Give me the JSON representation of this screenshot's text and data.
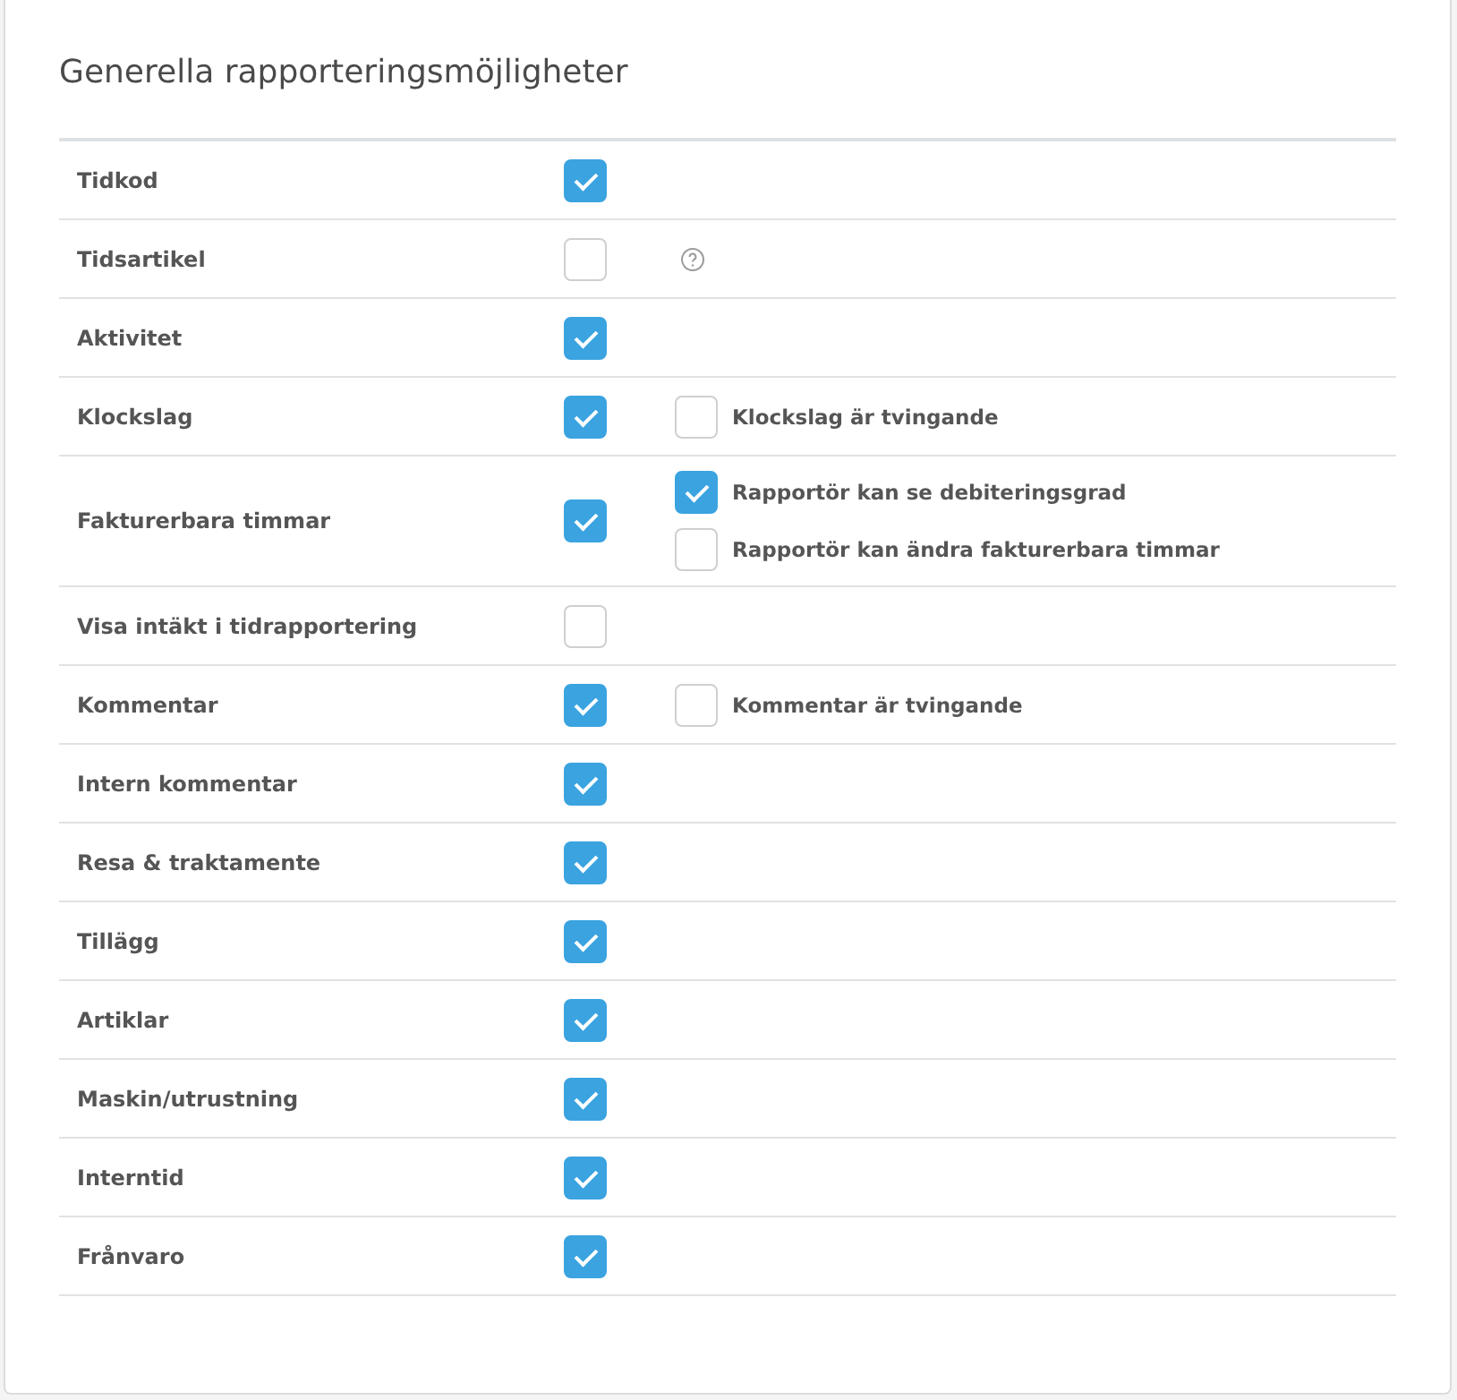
{
  "title": "Generella rapporteringsmöjligheter",
  "rows": [
    {
      "label": "Tidkod",
      "checked": true,
      "help": false,
      "options": []
    },
    {
      "label": "Tidsartikel",
      "checked": false,
      "help": true,
      "options": []
    },
    {
      "label": "Aktivitet",
      "checked": true,
      "help": false,
      "options": []
    },
    {
      "label": "Klockslag",
      "checked": true,
      "help": false,
      "options": [
        {
          "label": "Klockslag är tvingande",
          "checked": false
        }
      ]
    },
    {
      "label": "Fakturerbara timmar",
      "checked": true,
      "help": false,
      "options": [
        {
          "label": "Rapportör kan se debiteringsgrad",
          "checked": true
        },
        {
          "label": "Rapportör kan ändra fakturerbara timmar",
          "checked": false
        }
      ]
    },
    {
      "label": "Visa intäkt i tidrapportering",
      "checked": false,
      "help": false,
      "options": []
    },
    {
      "label": "Kommentar",
      "checked": true,
      "help": false,
      "options": [
        {
          "label": "Kommentar är tvingande",
          "checked": false
        }
      ]
    },
    {
      "label": "Intern kommentar",
      "checked": true,
      "help": false,
      "options": []
    },
    {
      "label": "Resa & traktamente",
      "checked": true,
      "help": false,
      "options": []
    },
    {
      "label": "Tillägg",
      "checked": true,
      "help": false,
      "options": []
    },
    {
      "label": "Artiklar",
      "checked": true,
      "help": false,
      "options": []
    },
    {
      "label": "Maskin/utrustning",
      "checked": true,
      "help": false,
      "options": []
    },
    {
      "label": "Interntid",
      "checked": true,
      "help": false,
      "options": []
    },
    {
      "label": "Frånvaro",
      "checked": true,
      "help": false,
      "options": []
    }
  ]
}
